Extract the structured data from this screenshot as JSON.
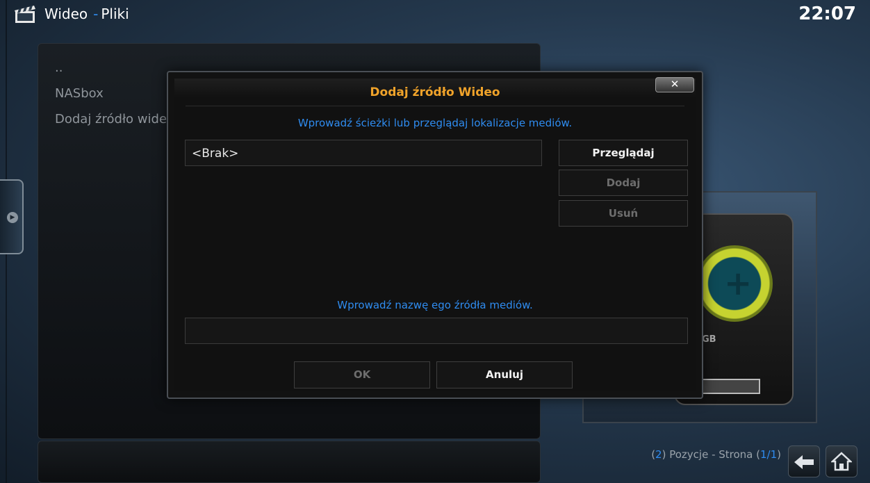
{
  "header": {
    "section": "Wideo",
    "separator": "-",
    "subsection": "Pliki",
    "clock": "22:07"
  },
  "file_list": {
    "items": [
      "..",
      "NASbox",
      "Dodaj źródło wideo"
    ]
  },
  "thumbnail": {
    "drive_label": "GB"
  },
  "footer": {
    "open_paren": "(",
    "count": "2",
    "close_paren": ")",
    "status_text": " Pozycje - Strona ",
    "page": "1/1",
    "back_icon": "back-arrow-icon",
    "home_icon": "home-icon"
  },
  "dialog": {
    "title": "Dodaj źródło Wideo",
    "close_label": "✕",
    "path_prompt": "Wprowadź ścieżki lub przeglądaj lokalizacje mediów.",
    "path_value": "<Brak>",
    "browse_label": "Przeglądaj",
    "add_label": "Dodaj",
    "remove_label": "Usuń",
    "name_prompt": "Wprowadź nazwę ego źródła mediów.",
    "name_value": "",
    "ok_label": "OK",
    "cancel_label": "Anuluj"
  },
  "colors": {
    "accent_blue": "#2f8cf0",
    "title_orange": "#f0a32a"
  }
}
